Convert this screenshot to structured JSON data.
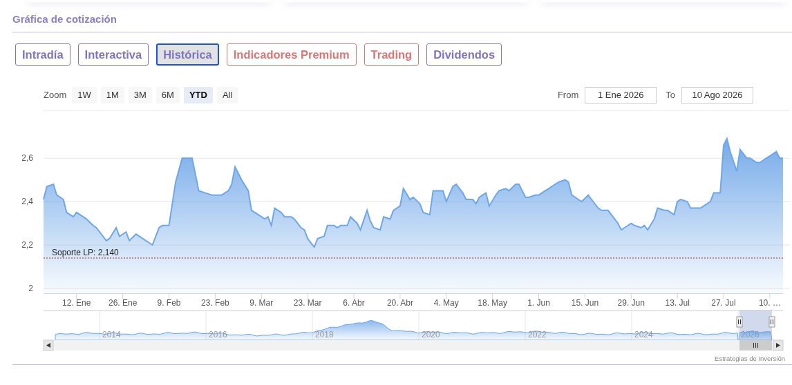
{
  "section_title": "Gráfica de cotización",
  "tabs": [
    {
      "label": "Intradía",
      "selected": false,
      "color": "#7d74c4"
    },
    {
      "label": "Interactiva",
      "selected": false,
      "color": "#7d74c4"
    },
    {
      "label": "Histórica",
      "selected": true,
      "color": "#7d74c4"
    },
    {
      "label": "Indicadores Premium",
      "selected": false,
      "color": "#e07474"
    },
    {
      "label": "Trading",
      "selected": false,
      "color": "#e07474"
    },
    {
      "label": "Dividendos",
      "selected": false,
      "color": "#7d74c4"
    }
  ],
  "range_selector": {
    "label": "Zoom",
    "buttons": [
      {
        "label": "1W",
        "selected": false
      },
      {
        "label": "1M",
        "selected": false
      },
      {
        "label": "3M",
        "selected": false
      },
      {
        "label": "6M",
        "selected": false
      },
      {
        "label": "YTD",
        "selected": true
      },
      {
        "label": "All",
        "selected": false
      }
    ]
  },
  "date_range": {
    "from_label": "From",
    "from_value": "1 Ene 2026",
    "to_label": "To",
    "to_value": "10 Ago 2026"
  },
  "chart": {
    "chart_data": {
      "type": "area",
      "xlim": [
        "2026-01-02",
        "2026-08-14"
      ],
      "ylim": [
        1.978,
        2.82
      ],
      "x": [
        "2026-01-02",
        "2026-01-03",
        "2026-01-05",
        "2026-01-06",
        "2026-01-08",
        "2026-01-09",
        "2026-01-11",
        "2026-01-12",
        "2026-01-15",
        "2026-01-17",
        "2026-01-18",
        "2026-01-20",
        "2026-01-21",
        "2026-01-22",
        "2026-01-24",
        "2026-01-25",
        "2026-01-27",
        "2026-01-28",
        "2026-01-30",
        "2026-02-01",
        "2026-02-03",
        "2026-02-04",
        "2026-02-06",
        "2026-02-07",
        "2026-02-09",
        "2026-02-11",
        "2026-02-13",
        "2026-02-14",
        "2026-02-16",
        "2026-02-18",
        "2026-02-20",
        "2026-02-22",
        "2026-02-25",
        "2026-02-27",
        "2026-02-28",
        "2026-03-01",
        "2026-03-03",
        "2026-03-05",
        "2026-03-06",
        "2026-03-09",
        "2026-03-10",
        "2026-03-11",
        "2026-03-12",
        "2026-03-13",
        "2026-03-15",
        "2026-03-16",
        "2026-03-18",
        "2026-03-19",
        "2026-03-21",
        "2026-03-22",
        "2026-03-23",
        "2026-03-25",
        "2026-03-26",
        "2026-03-28",
        "2026-03-29",
        "2026-03-31",
        "2026-04-01",
        "2026-04-02",
        "2026-04-04",
        "2026-04-05",
        "2026-04-07",
        "2026-04-08",
        "2026-04-10",
        "2026-04-11",
        "2026-04-12",
        "2026-04-14",
        "2026-04-15",
        "2026-04-17",
        "2026-04-18",
        "2026-04-20",
        "2026-04-21",
        "2026-04-23",
        "2026-04-24",
        "2026-04-26",
        "2026-04-27",
        "2026-04-29",
        "2026-04-30",
        "2026-05-02",
        "2026-05-03",
        "2026-05-04",
        "2026-05-06",
        "2026-05-07",
        "2026-05-09",
        "2026-05-10",
        "2026-05-12",
        "2026-05-13",
        "2026-05-14",
        "2026-05-16",
        "2026-05-17",
        "2026-05-19",
        "2026-05-20",
        "2026-05-22",
        "2026-05-23",
        "2026-05-25",
        "2026-05-26",
        "2026-05-28",
        "2026-05-29",
        "2026-05-31",
        "2026-06-01",
        "2026-06-03",
        "2026-06-04",
        "2026-06-06",
        "2026-06-07",
        "2026-06-09",
        "2026-06-10",
        "2026-06-11",
        "2026-06-13",
        "2026-06-14",
        "2026-06-16",
        "2026-06-17",
        "2026-06-19",
        "2026-06-20",
        "2026-06-22",
        "2026-06-23",
        "2026-06-25",
        "2026-06-26",
        "2026-06-27",
        "2026-06-29",
        "2026-06-30",
        "2026-07-02",
        "2026-07-03",
        "2026-07-04",
        "2026-07-06",
        "2026-07-07",
        "2026-07-09",
        "2026-07-10",
        "2026-07-12",
        "2026-07-13",
        "2026-07-14",
        "2026-07-16",
        "2026-07-17",
        "2026-07-19",
        "2026-07-20",
        "2026-07-22",
        "2026-07-23",
        "2026-07-24",
        "2026-07-26",
        "2026-07-27",
        "2026-07-28",
        "2026-07-29",
        "2026-07-31",
        "2026-08-01",
        "2026-08-03",
        "2026-08-04",
        "2026-08-06",
        "2026-08-07",
        "2026-08-09",
        "2026-08-10",
        "2026-08-12",
        "2026-08-13",
        "2026-08-14"
      ],
      "series": [
        {
          "color": "#6ea6e8",
          "values": [
            2.41,
            2.47,
            2.48,
            2.43,
            2.41,
            2.35,
            2.33,
            2.35,
            2.32,
            2.29,
            2.28,
            2.24,
            2.22,
            2.23,
            2.28,
            2.24,
            2.26,
            2.22,
            2.25,
            2.23,
            2.21,
            2.2,
            2.28,
            2.29,
            2.29,
            2.49,
            2.6,
            2.6,
            2.6,
            2.45,
            2.44,
            2.43,
            2.43,
            2.45,
            2.48,
            2.56,
            2.5,
            2.45,
            2.36,
            2.33,
            2.32,
            2.33,
            2.29,
            2.37,
            2.35,
            2.33,
            2.33,
            2.32,
            2.28,
            2.27,
            2.23,
            2.19,
            2.23,
            2.24,
            2.29,
            2.29,
            2.28,
            2.29,
            2.29,
            2.33,
            2.3,
            2.27,
            2.36,
            2.31,
            2.28,
            2.27,
            2.33,
            2.32,
            2.36,
            2.38,
            2.46,
            2.41,
            2.42,
            2.39,
            2.35,
            2.34,
            2.45,
            2.45,
            2.45,
            2.4,
            2.47,
            2.48,
            2.44,
            2.41,
            2.41,
            2.39,
            2.42,
            2.44,
            2.38,
            2.43,
            2.45,
            2.46,
            2.45,
            2.48,
            2.48,
            2.42,
            2.42,
            2.43,
            2.43,
            2.45,
            2.46,
            2.48,
            2.49,
            2.5,
            2.49,
            2.43,
            2.41,
            2.4,
            2.43,
            2.41,
            2.37,
            2.36,
            2.36,
            2.34,
            2.3,
            2.27,
            2.28,
            2.3,
            2.29,
            2.28,
            2.29,
            2.27,
            2.32,
            2.37,
            2.36,
            2.36,
            2.34,
            2.4,
            2.41,
            2.4,
            2.37,
            2.37,
            2.37,
            2.39,
            2.4,
            2.44,
            2.44,
            2.66,
            2.69,
            2.63,
            2.54,
            2.64,
            2.6,
            2.6,
            2.58,
            2.58,
            2.6,
            2.61,
            2.63,
            2.6,
            2.6
          ]
        }
      ],
      "xticks": [
        {
          "value": "2026-01-12",
          "label": "12. Ene"
        },
        {
          "value": "2026-01-26",
          "label": "26. Ene"
        },
        {
          "value": "2026-02-09",
          "label": "9. Feb"
        },
        {
          "value": "2026-02-23",
          "label": "23. Feb"
        },
        {
          "value": "2026-03-09",
          "label": "9. Mar"
        },
        {
          "value": "2026-03-23",
          "label": "23. Mar"
        },
        {
          "value": "2026-04-06",
          "label": "6. Abr"
        },
        {
          "value": "2026-04-20",
          "label": "20. Abr"
        },
        {
          "value": "2026-05-04",
          "label": "4. May"
        },
        {
          "value": "2026-05-18",
          "label": "18. May"
        },
        {
          "value": "2026-06-01",
          "label": "1. Jun"
        },
        {
          "value": "2026-06-15",
          "label": "15. Jun"
        },
        {
          "value": "2026-06-29",
          "label": "29. Jun"
        },
        {
          "value": "2026-07-13",
          "label": "13. Jul"
        },
        {
          "value": "2026-07-27",
          "label": "27. Jul"
        },
        {
          "value": "2026-08-10",
          "label": "10. …"
        }
      ],
      "yticks": [
        {
          "value": 2,
          "label": "2"
        },
        {
          "value": 2.2,
          "label": "2,2"
        },
        {
          "value": 2.4,
          "label": "2,4"
        },
        {
          "value": 2.6,
          "label": "2,6"
        }
      ],
      "grid": true,
      "ref_lines": [
        {
          "axis": "y",
          "value": 2.14,
          "label": "Soporte LP: 2,140",
          "color": "#b22222"
        }
      ]
    }
  },
  "navigator": {
    "year_labels": [
      "2014",
      "2016",
      "2018",
      "2020",
      "2022",
      "2024",
      "2026"
    ]
  },
  "credit": "Estrategias de Inversión"
}
